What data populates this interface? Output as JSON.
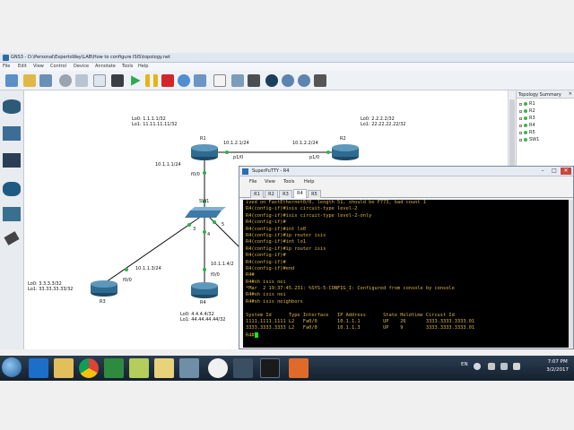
{
  "gns3": {
    "title": "GNS3 - D:\\Personal\\ExpertsWay\\LAB\\How to configure ISIS\\topology.net",
    "menu": [
      "File",
      "Edit",
      "View",
      "Control",
      "Device",
      "Annotate",
      "Tools",
      "Help"
    ]
  },
  "topology_summary": {
    "title": "Topology Summary",
    "items": [
      "R1",
      "R2",
      "R3",
      "R4",
      "R5",
      "SW1"
    ]
  },
  "canvas": {
    "r1": {
      "name": "R1",
      "lo0": "Lo0: 1.1.1.1/32",
      "lo1": "Lo1: 11.11.11.11/32"
    },
    "r2": {
      "name": "R2",
      "lo0": "Lo0: 2.2.2.2/32",
      "lo1": "Lo1: 22.22.22.22/32"
    },
    "r3": {
      "name": "R3",
      "lo0": "Lo0: 3.3.3.3/32",
      "lo1": "Lo1: 33.33.33.33/32"
    },
    "r4": {
      "name": "R4",
      "lo0": "Lo0: 4.4.4.4/32",
      "lo1": "Lo1: 44.44.44.44/32"
    },
    "sw1": {
      "name": "SW1"
    },
    "links": {
      "r1_r2_left_ip": "10.1.2.1/24",
      "r1_r2_right_ip": "10.1.2.2/24",
      "r1_p10": "p1/0",
      "r2_p10": "p1/0",
      "r1_f00": "f0/0",
      "r1_down_ip": "10.1.1.1/24",
      "sw_port3": "3",
      "sw_port4": "4",
      "sw_port5": "5",
      "r3_ip": "10.1.1.3/24",
      "r3_f00": "f0/0",
      "r4_ip": "10.1.1.4/2",
      "r4_f00": "f0/0"
    }
  },
  "putty": {
    "title": "SuperPuTTY - R4",
    "menu": [
      "File",
      "View",
      "Tools",
      "Help"
    ],
    "tabs": [
      "R1",
      "R2",
      "R3",
      "R4",
      "R5"
    ],
    "active_tab": "R4",
    "lines": [
      "ived on FastEthernet0/0, length 51, should be F773, bad count 1",
      "R4(config-if)#isis circuit-type level-2",
      "R4(config-if)#isis circuit-type level-2-only",
      "R4(config-if)#",
      "R4(config-if)#int lo0",
      "R4(config-if)#ip router isis",
      "R4(config-if)#int lo1",
      "R4(config-if)#ip router isis",
      "R4(config-if)#",
      "R4(config-if)#",
      "R4(config-if)#end",
      "R4#",
      "R4#sh isis nei",
      "*Mar  2 19:37:45.231: %SYS-5-CONFIG_I: Configured from console by console",
      "R4#sh isis nei",
      "R4#sh isis neighbors",
      "",
      "System Id      Type Interface   IP Address      State Holdtime Circuit Id",
      "1111.1111.1111 L2   Fa0/0       10.1.1.1        UP    26       3333.3333.3333.01",
      "3333.3333.3333 L2   Fa0/0       10.1.1.3        UP    9        3333.3333.3333.01",
      "R4#"
    ]
  },
  "taskbar": {
    "language": "EN",
    "time": "7:07 PM",
    "date": "3/2/2017"
  }
}
